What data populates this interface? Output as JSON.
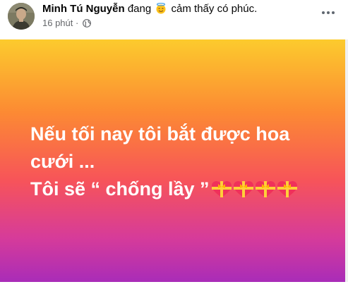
{
  "post": {
    "author_name": "Minh Tú Nguyễn",
    "feeling_prefix": "đang",
    "feeling_emoji_icon": "smiling-face-with-halo-icon",
    "feeling_text": "cảm thấy có phúc.",
    "timestamp": "16 phút",
    "separator": "·",
    "privacy_icon": "globe-icon",
    "more_icon": "more-options-icon"
  },
  "status": {
    "line1": "Nếu tối nay tôi bắt được hoa",
    "line2": "cưới ...",
    "line3": "Tôi sẽ “ chống lầy ”",
    "trailing_icons": [
      "heart-with-ribbon-icon",
      "heart-with-ribbon-icon",
      "heart-with-ribbon-icon",
      "heart-with-ribbon-icon"
    ],
    "background_colors": [
      "#fccb2d",
      "#fc8a33",
      "#f75459",
      "#d63b9a",
      "#a92cb8"
    ]
  },
  "colors": {
    "text_primary": "#050505",
    "text_secondary": "#65676b",
    "status_text": "#ffffff"
  }
}
